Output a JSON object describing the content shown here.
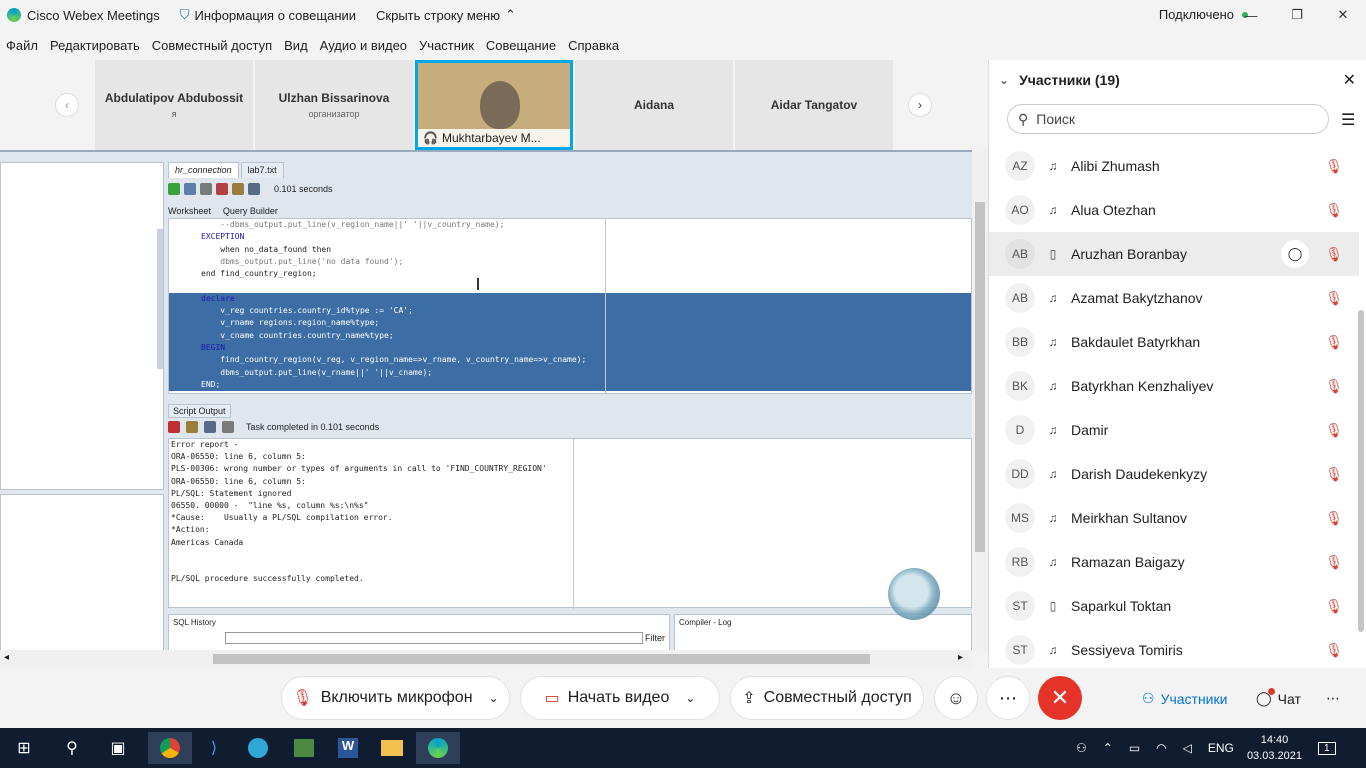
{
  "titlebar": {
    "app_title": "Cisco Webex Meetings",
    "meeting_info": "Информация о совещании",
    "hide_menu": "Скрыть строку меню",
    "status": "Подключено"
  },
  "menu": [
    "Файл",
    "Редактировать",
    "Совместный доступ",
    "Вид",
    "Аудио и видео",
    "Участник",
    "Совещание",
    "Справка"
  ],
  "video_tiles": [
    {
      "name": "Abdulatipov Abdubossit",
      "role": "я"
    },
    {
      "name": "Ulzhan Bissarinova",
      "role": "организатор"
    },
    {
      "name": "Mukhtarbayev M...",
      "role": ""
    },
    {
      "name": "Aidana",
      "role": ""
    },
    {
      "name": "Aidar Tangatov",
      "role": ""
    }
  ],
  "editor": {
    "tabs": [
      "hr_connection",
      "lab7.txt"
    ],
    "elapsed": "0.101 seconds",
    "subtabs": [
      "Worksheet",
      "Query Builder"
    ],
    "code_lines": [
      "    --dbms_output.put_line(v_region_name||' '||v_country_name);",
      "EXCEPTION",
      "    when no_data_found then",
      "    dbms_output.put_line('no data found');",
      "end find_country_region;",
      "",
      "declare",
      "    v_reg countries.country_id%type := 'CA';",
      "    v_rname regions.region_name%type;",
      "    v_cname countries.country_name%type;",
      "BEGIN",
      "    find_country_region(v_reg, v_region_name=>v_rname, v_country_name=>v_cname);",
      "    dbms_output.put_line(v_rname||' '||v_cname);",
      "END;"
    ],
    "script_output_tab": "Script Output",
    "task_status": "Task completed in 0.101 seconds",
    "output_lines": [
      "Error report -",
      "ORA-06550: line 6, column 5:",
      "PLS-00306: wrong number or types of arguments in call to 'FIND_COUNTRY_REGION'",
      "ORA-06550: line 6, column 5:",
      "PL/SQL: Statement ignored",
      "06550. 00000 -  \"line %s, column %s:\\n%s\"",
      "*Cause:    Usually a PL/SQL compilation error.",
      "*Action:",
      "Americas Canada",
      "",
      "",
      "PL/SQL procedure successfully completed."
    ],
    "sql_history": "SQL History",
    "filter": "Filter",
    "compiler_log": "Compiler - Log"
  },
  "participants": {
    "header": "Участники (19)",
    "search_placeholder": "Поиск",
    "list": [
      {
        "initials": "AZ",
        "name": "Alibi Zhumash",
        "device": "headset"
      },
      {
        "initials": "AO",
        "name": "Alua Otezhan",
        "device": "headset"
      },
      {
        "initials": "AB",
        "name": "Aruzhan Boranbay",
        "device": "phone"
      },
      {
        "initials": "AB",
        "name": "Azamat Bakytzhanov",
        "device": "headset"
      },
      {
        "initials": "BB",
        "name": "Bakdaulet Batyrkhan",
        "device": "headset"
      },
      {
        "initials": "BK",
        "name": "Batyrkhan Kenzhaliyev",
        "device": "headset"
      },
      {
        "initials": "D",
        "name": "Damir",
        "device": "headset"
      },
      {
        "initials": "DD",
        "name": "Darish Daudekenkyzy",
        "device": "headset"
      },
      {
        "initials": "MS",
        "name": "Meirkhan Sultanov",
        "device": "headset"
      },
      {
        "initials": "RB",
        "name": "Ramazan Baigazy",
        "device": "headset"
      },
      {
        "initials": "ST",
        "name": "Saparkul Toktan",
        "device": "phone"
      },
      {
        "initials": "ST",
        "name": "Sessiyeva Tomiris",
        "device": "headset"
      }
    ]
  },
  "controls": {
    "mic": "Включить микрофон",
    "video": "Начать видео",
    "share": "Совместный доступ",
    "participants": "Участники",
    "chat": "Чат"
  },
  "taskbar": {
    "lang": "ENG",
    "time": "14:40",
    "date": "03.03.2021",
    "notifications": "1"
  },
  "colors": {
    "end_call": "#e5332a",
    "accent": "#0074d9",
    "mute_red": "#d83b2e",
    "selection": "#3c6ea5"
  }
}
